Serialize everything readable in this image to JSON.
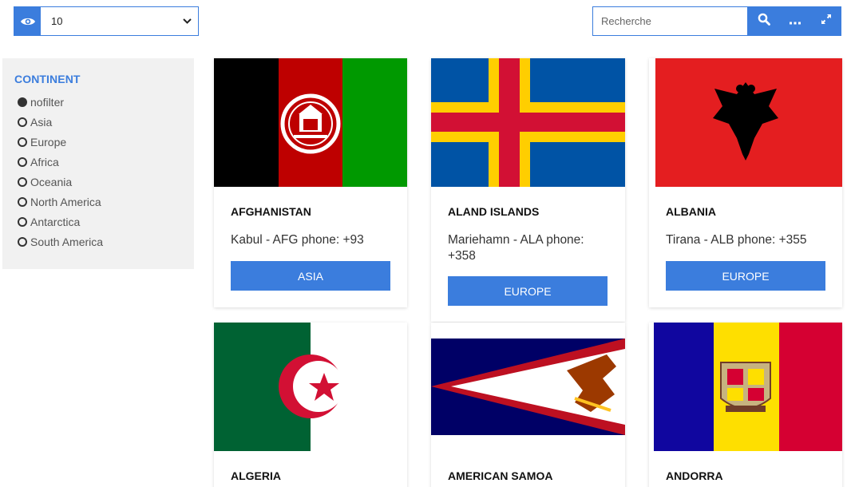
{
  "toolbar": {
    "per_page_value": "10",
    "search_placeholder": "Recherche"
  },
  "filter": {
    "title": "CONTINENT",
    "options": [
      {
        "label": "nofilter",
        "checked": true
      },
      {
        "label": "Asia",
        "checked": false
      },
      {
        "label": "Europe",
        "checked": false
      },
      {
        "label": "Africa",
        "checked": false
      },
      {
        "label": "Oceania",
        "checked": false
      },
      {
        "label": "North America",
        "checked": false
      },
      {
        "label": "Antarctica",
        "checked": false
      },
      {
        "label": "South America",
        "checked": false
      }
    ]
  },
  "countries": [
    {
      "name": "AFGHANISTAN",
      "info": "Kabul - AFG phone: +93",
      "continent": "ASIA",
      "flag": "afghanistan-flag"
    },
    {
      "name": "ALAND ISLANDS",
      "info": "Mariehamn - ALA phone: +358",
      "continent": "EUROPE",
      "flag": "aland-islands-flag"
    },
    {
      "name": "ALBANIA",
      "info": "Tirana - ALB phone: +355",
      "continent": "EUROPE",
      "flag": "albania-flag"
    },
    {
      "name": "ALGERIA",
      "info": "",
      "continent": "",
      "flag": "algeria-flag"
    },
    {
      "name": "AMERICAN SAMOA",
      "info": "",
      "continent": "",
      "flag": "american-samoa-flag"
    },
    {
      "name": "ANDORRA",
      "info": "",
      "continent": "",
      "flag": "andorra-flag"
    }
  ],
  "colors": {
    "accent": "#3b7ddd",
    "sidebar_bg": "#f1f1f1"
  }
}
